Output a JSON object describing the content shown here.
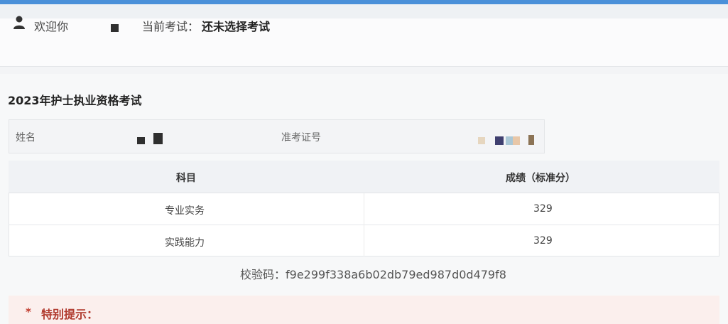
{
  "header": {
    "user_icon": "user-icon",
    "welcome": "欢迎你",
    "current_exam_label": "当前考试：",
    "current_exam_value": "还未选择考试"
  },
  "exam": {
    "title": "2023年护士执业资格考试"
  },
  "info": {
    "name_label": "姓名",
    "id_label": "准考证号"
  },
  "table": {
    "columns": [
      "科目",
      "成绩（标准分）"
    ],
    "rows": [
      {
        "subject": "专业实务",
        "score": "329"
      },
      {
        "subject": "实践能力",
        "score": "329"
      }
    ]
  },
  "checksum": "校验码：f9e299f338a6b02db79ed987d0d479f8",
  "notice": {
    "star": "*",
    "title": "特别提示："
  },
  "colors": {
    "accent": "#4a90d9",
    "notice_text": "#b03a2e"
  }
}
